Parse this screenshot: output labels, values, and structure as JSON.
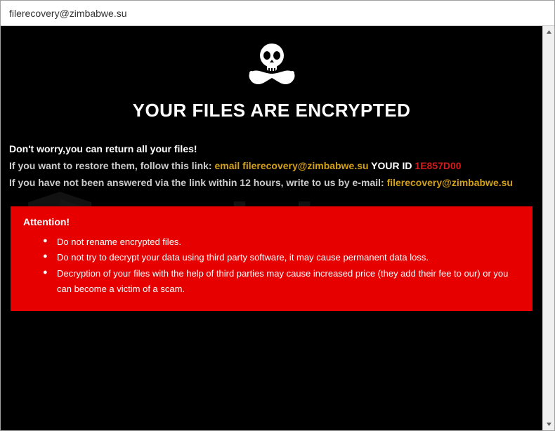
{
  "window": {
    "title": "filerecovery@zimbabwe.su"
  },
  "content": {
    "heading": "YOUR FILES ARE ENCRYPTED",
    "line1": "Don't worry,you can return all your files!",
    "line2_prefix": "If you want to restore them, follow this link: ",
    "line2_email_label": "email filerecovery@zimbabwe.su",
    "line2_id_label": "  YOUR ID ",
    "line2_id_value": "1E857D00",
    "line3_prefix": "If you have not been answered via the link within 12 hours, write to us by e-mail: ",
    "line3_email": "filerecovery@zimbabwe.su"
  },
  "attention": {
    "title": "Attention!",
    "items": [
      "Do not rename encrypted files.",
      "Do not try to decrypt your data using third party software, it may cause permanent data loss.",
      "Decryption of your files with the help of third parties may cause increased price (they add their fee to our) or you can become a victim of a scam."
    ]
  },
  "watermark": {
    "text": "pcrisk.com"
  }
}
